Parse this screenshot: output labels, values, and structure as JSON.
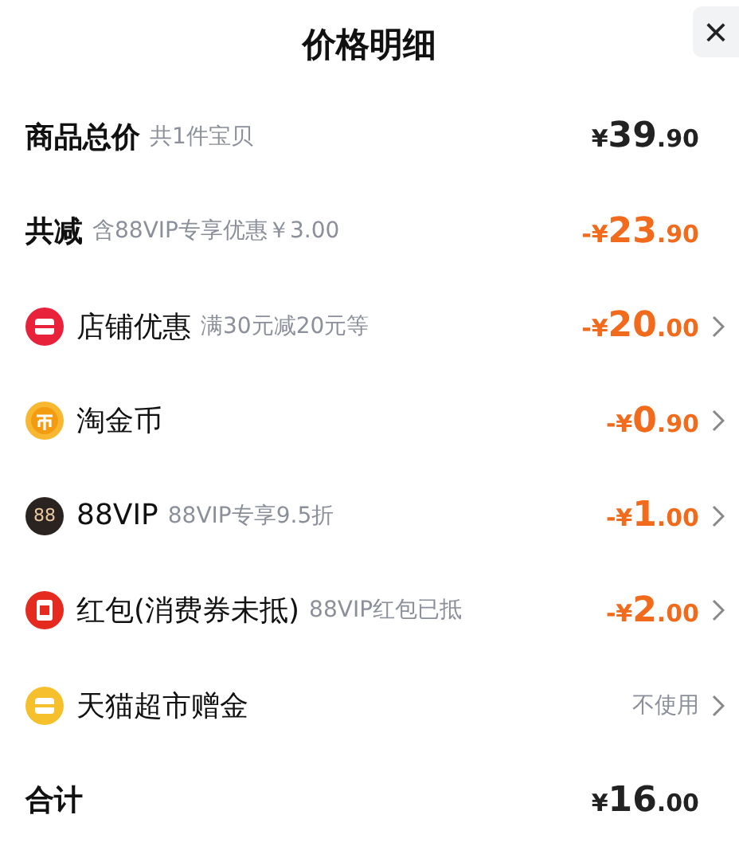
{
  "header": {
    "title": "价格明细",
    "close": "×"
  },
  "rows": [
    {
      "kind": "summary",
      "label": "商品总价",
      "note": "共1件宝贝",
      "amount": "¥39.90",
      "discount": false,
      "has_arrow": false
    },
    {
      "kind": "summary",
      "label": "共减",
      "note": "含88VIP专享优惠￥3.00",
      "amount": "-¥23.90",
      "discount": true,
      "has_arrow": false
    },
    {
      "kind": "shop",
      "label": "店铺优惠",
      "note": "满30元减20元等",
      "amount": "-¥20.00",
      "discount": true,
      "has_arrow": true
    },
    {
      "kind": "coin",
      "label": "淘金币",
      "amount": "-¥0.90",
      "discount": true,
      "has_arrow": true
    },
    {
      "kind": "vip",
      "icon_text": "88",
      "label": "88VIP",
      "note": "88VIP专享9.5折",
      "amount": "-¥1.00",
      "discount": true,
      "has_arrow": true
    },
    {
      "kind": "packet",
      "label": "红包(消费券未抵)",
      "note": "88VIP红包已抵",
      "amount": "-¥2.00",
      "discount": true,
      "has_arrow": true
    },
    {
      "kind": "gift",
      "label": "天猫超市赠金",
      "amount": "不使用",
      "discount": false,
      "has_arrow": true
    },
    {
      "kind": "summary",
      "label": "合计",
      "amount": "¥16.00",
      "discount": false,
      "has_arrow": false
    }
  ]
}
